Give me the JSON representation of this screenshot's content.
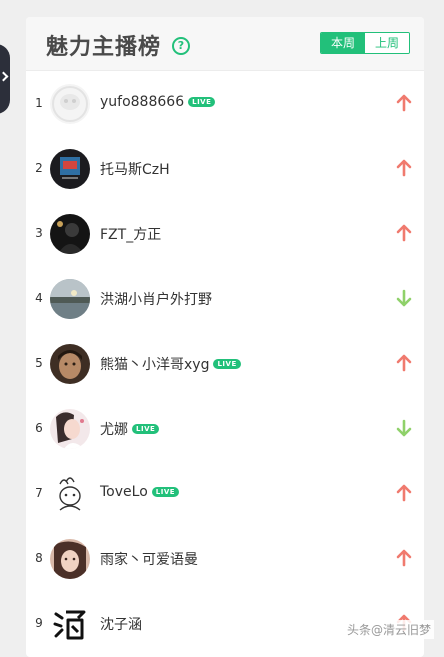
{
  "header": {
    "title": "魅力主播榜",
    "help_icon": "question-circle-icon",
    "tabs": [
      {
        "label": "本周",
        "active": true
      },
      {
        "label": "上周",
        "active": false
      }
    ]
  },
  "colors": {
    "accent": "#22c07a",
    "trend_up": "#f07a6e",
    "trend_down": "#8fd16a"
  },
  "ranking": [
    {
      "rank": "1",
      "name": "yufo888666",
      "live": true,
      "trend": "up"
    },
    {
      "rank": "2",
      "name": "托马斯CzH",
      "live": false,
      "trend": "up"
    },
    {
      "rank": "3",
      "name": "FZT_方正",
      "live": false,
      "trend": "up"
    },
    {
      "rank": "4",
      "name": "洪湖小肖户外打野",
      "live": false,
      "trend": "down"
    },
    {
      "rank": "5",
      "name": "熊猫丶小洋哥xyg",
      "live": true,
      "trend": "up"
    },
    {
      "rank": "6",
      "name": "尤娜",
      "live": true,
      "trend": "down"
    },
    {
      "rank": "7",
      "name": "ToveLo",
      "live": true,
      "trend": "up"
    },
    {
      "rank": "8",
      "name": "雨家丶可爱语曼",
      "live": false,
      "trend": "up"
    },
    {
      "rank": "9",
      "name": "沈子涵",
      "live": false,
      "trend": "up"
    }
  ],
  "live_badge_label": "LIVE",
  "watermark": "头条@清云旧梦"
}
